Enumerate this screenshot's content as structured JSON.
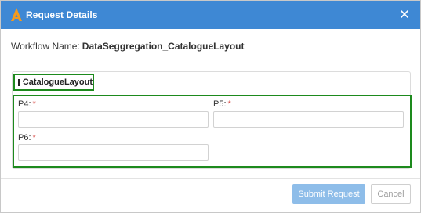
{
  "window": {
    "title": "Request Details",
    "logo_icon": "orange-a-logo-icon",
    "close_icon": "close-icon",
    "header_color": "#3e88d4"
  },
  "workflow": {
    "label": "Workflow Name:",
    "value": "DataSeggregation_CatalogueLayout"
  },
  "section": {
    "title": "CatalogueLayout",
    "collapse_icon": "minus-square-icon",
    "expanded": true
  },
  "fields": [
    {
      "label": "P4:",
      "required_mark": "*",
      "value": "",
      "placeholder": ""
    },
    {
      "label": "P5:",
      "required_mark": "*",
      "value": "",
      "placeholder": ""
    },
    {
      "label": "P6:",
      "required_mark": "*",
      "value": "",
      "placeholder": ""
    }
  ],
  "buttons": {
    "submit_label": "Submit Request",
    "cancel_label": "Cancel"
  },
  "colors": {
    "highlight": "#1d8a1d",
    "required": "#d9534f",
    "submit_bg": "#8ebde9"
  }
}
